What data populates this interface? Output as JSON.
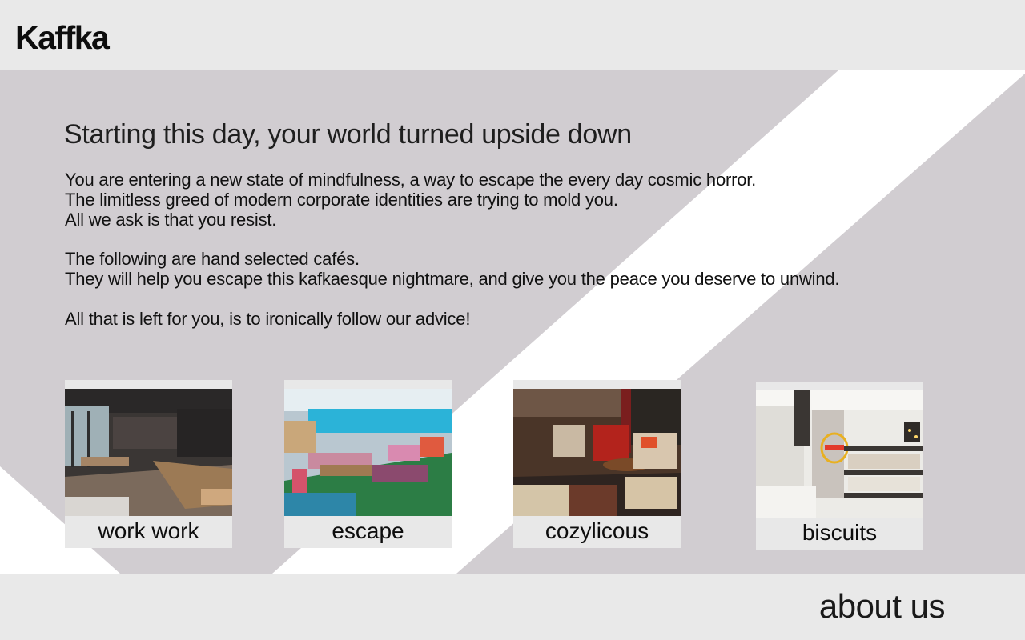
{
  "header": {
    "logo": "Kaffka"
  },
  "main": {
    "headline": "Starting this day, your world turned upside down",
    "paragraphs": [
      "You are entering a new state of mindfulness, a way to escape the every day cosmic horror.",
      "The limitless greed of modern corporate identities are trying to mold you.",
      "All we ask is that you resist.",
      "The following are hand selected cafés.",
      "They will help you escape this kafkaesque nightmare, and give you the peace you deserve to unwind.",
      "All that is left for you, is to ironically follow our advice!"
    ],
    "cafes": [
      {
        "label": "work work"
      },
      {
        "label": "escape"
      },
      {
        "label": "cozylicous"
      },
      {
        "label": "biscuits"
      }
    ]
  },
  "footer": {
    "about": "about us"
  },
  "colors": {
    "bar": "#e9e9e9",
    "background": "#d1cdd1",
    "stripe": "#ffffff"
  }
}
